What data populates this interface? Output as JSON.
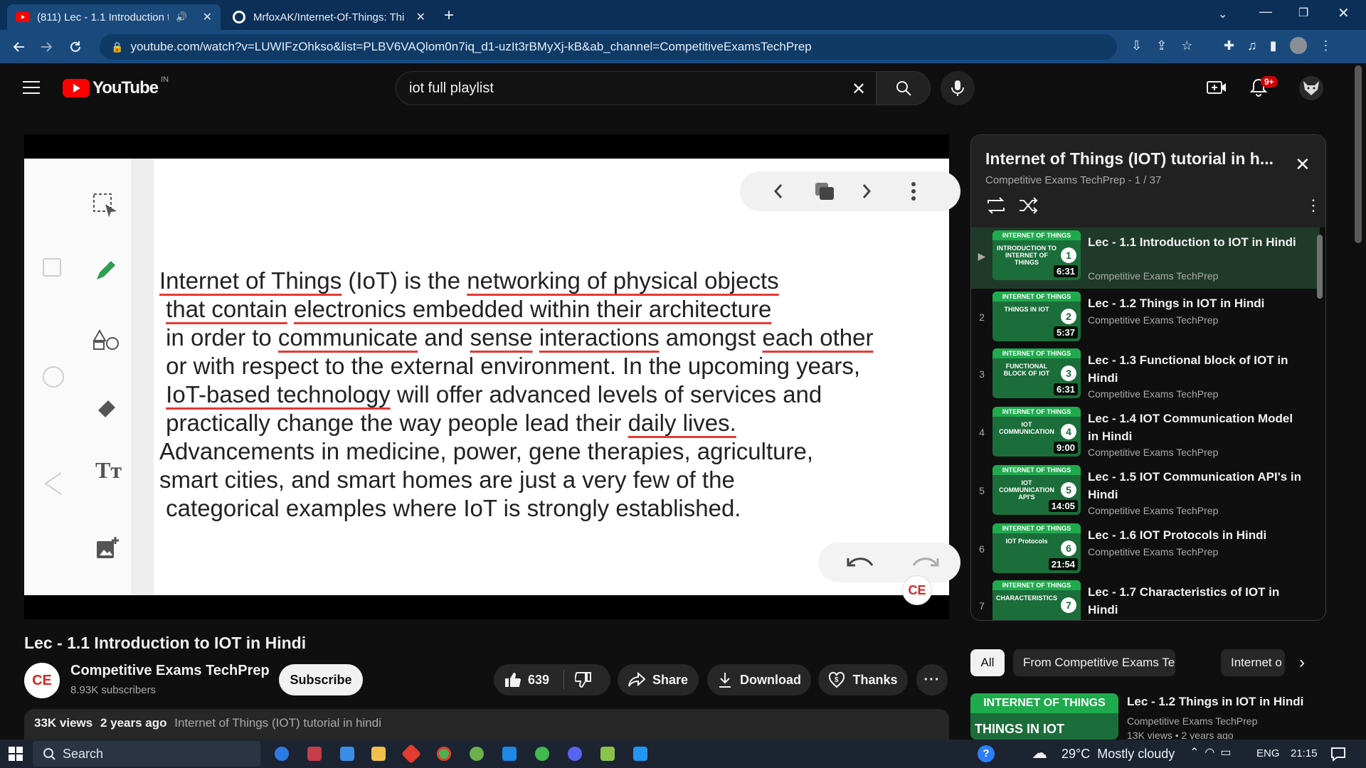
{
  "browser": {
    "tabs": [
      {
        "title": "(811) Lec - 1.1 Introduction t",
        "active": true
      },
      {
        "title": "MrfoxAK/Internet-Of-Things: Thi",
        "active": false
      }
    ],
    "url": "youtube.com/watch?v=LUWIFzOhkso&list=PLBV6VAQlom0n7iq_d1-uzIt3rBMyXj-kB&ab_channel=CompetitiveExamsTechPrep"
  },
  "youtube": {
    "logo_text": "YouTube",
    "region": "IN",
    "search_value": "iot full playlist",
    "notifications": "9+"
  },
  "slide": {
    "lines": [
      [
        {
          "t": "Internet of Things",
          "u": true
        },
        {
          "t": " (IoT) is the ",
          "u": false
        },
        {
          "t": "networking of physical objects",
          "u": true
        }
      ],
      [
        {
          "t": " ",
          "u": false
        },
        {
          "t": "that contain",
          "u": true
        },
        {
          "t": " ",
          "u": false
        },
        {
          "t": "electronics embedded within their architecture",
          "u": true
        }
      ],
      [
        {
          "t": " in order to ",
          "u": false
        },
        {
          "t": "communicate",
          "u": true
        },
        {
          "t": " and ",
          "u": false
        },
        {
          "t": "sense",
          "u": true
        },
        {
          "t": " ",
          "u": false
        },
        {
          "t": "interactions",
          "u": true
        },
        {
          "t": " amongst ",
          "u": false
        },
        {
          "t": "each other",
          "u": true
        }
      ],
      [
        {
          "t": " or with respect to the external environment. In the upcoming years,",
          "u": false
        }
      ],
      [
        {
          "t": " ",
          "u": false
        },
        {
          "t": "IoT-based technology",
          "u": true
        },
        {
          "t": " will offer advanced levels of services and",
          "u": false
        }
      ],
      [
        {
          "t": " practically change the way people lead their ",
          "u": false
        },
        {
          "t": "daily lives.",
          "u": true
        }
      ],
      [
        {
          "t": "Advancements in medicine, power, gene therapies, agriculture,",
          "u": false
        }
      ],
      [
        {
          "t": "smart cities, and smart homes are just a very few of the",
          "u": false
        }
      ],
      [
        {
          "t": " categorical examples where IoT is strongly established.",
          "u": false
        }
      ]
    ],
    "watermark": "CE"
  },
  "video": {
    "title": "Lec - 1.1 Introduction to IOT in Hindi",
    "channel": "Competitive Exams TechPrep",
    "subscribers": "8.93K subscribers",
    "subscribe_label": "Subscribe",
    "likes": "639",
    "share_label": "Share",
    "download_label": "Download",
    "thanks_label": "Thanks",
    "views": "33K views",
    "age": "2 years ago",
    "playlist_link": "Internet of Things (IOT) tutorial in hindi"
  },
  "playlist": {
    "title": "Internet of Things (IOT) tutorial in h...",
    "meta": "Competitive Exams TechPrep - 1 / 37",
    "items": [
      {
        "idx": "▶",
        "title": "Lec - 1.1 Introduction to IOT in Hindi",
        "channel": "Competitive Exams TechPrep",
        "duration": "6:31",
        "num": "1",
        "thumb_band": "INTERNET OF THINGS",
        "thumb_text": "INTRODUCTION TO INTERNET OF THINGS",
        "active": true
      },
      {
        "idx": "2",
        "title": "Lec - 1.2 Things in IOT in Hindi",
        "channel": "Competitive Exams TechPrep",
        "duration": "5:37",
        "num": "2",
        "thumb_band": "INTERNET OF THINGS",
        "thumb_text": "THINGS IN IOT",
        "active": false
      },
      {
        "idx": "3",
        "title": "Lec - 1.3 Functional block of IOT in Hindi",
        "channel": "Competitive Exams TechPrep",
        "duration": "6:31",
        "num": "3",
        "thumb_band": "INTERNET OF THINGS",
        "thumb_text": "FUNCTIONAL BLOCK OF IOT",
        "active": false
      },
      {
        "idx": "4",
        "title": "Lec - 1.4 IOT Communication Model in Hindi",
        "channel": "Competitive Exams TechPrep",
        "duration": "9:00",
        "num": "4",
        "thumb_band": "INTERNET OF THINGS",
        "thumb_text": "IOT COMMUNICATION",
        "active": false
      },
      {
        "idx": "5",
        "title": "Lec - 1.5 IOT Communication API's in Hindi",
        "channel": "Competitive Exams TechPrep",
        "duration": "14:05",
        "num": "5",
        "thumb_band": "INTERNET OF THINGS",
        "thumb_text": "IOT COMMUNICATION API'S",
        "active": false
      },
      {
        "idx": "6",
        "title": "Lec - 1.6 IOT Protocols in Hindi",
        "channel": "Competitive Exams TechPrep",
        "duration": "21:54",
        "num": "6",
        "thumb_band": "INTERNET OF THINGS",
        "thumb_text": "IOT Protocols",
        "active": false
      },
      {
        "idx": "7",
        "title": "Lec - 1.7 Characteristics of IOT in Hindi",
        "channel": "",
        "duration": "",
        "num": "7",
        "thumb_band": "INTERNET OF THINGS",
        "thumb_text": "CHARACTERISTICS",
        "active": false
      }
    ]
  },
  "chips": [
    "All",
    "From Competitive Exams Tec...",
    "Internet o"
  ],
  "recommendation": {
    "thumb_band": "INTERNET OF THINGS",
    "thumb_text": "THINGS IN IOT",
    "title": "Lec - 1.2 Things in IOT in Hindi",
    "channel": "Competitive Exams TechPrep",
    "meta": "13K views • 2 years ago"
  },
  "taskbar": {
    "search_placeholder": "Search",
    "weather": "29°C  Mostly cloudy",
    "lang": "ENG",
    "time": "21:15"
  },
  "colors": {
    "accent_red": "#ff0000",
    "underline_red": "#e53935",
    "playlist_green": "#1faa4d"
  }
}
